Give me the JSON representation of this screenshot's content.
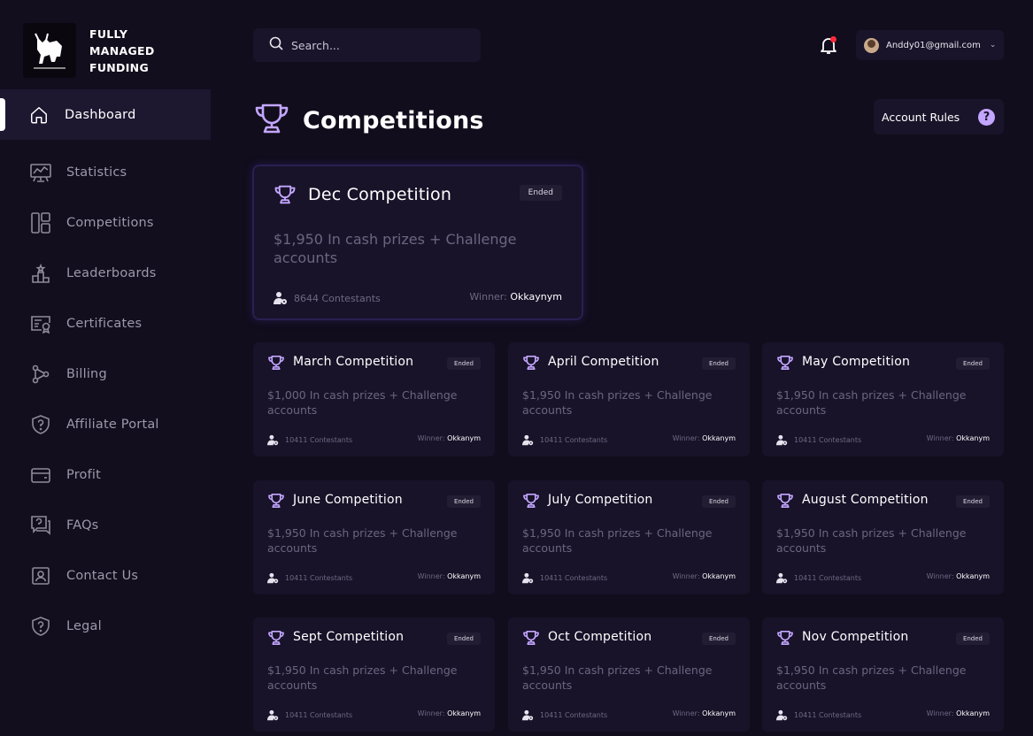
{
  "brand": {
    "line1": "FULLY",
    "line2": "MANAGED",
    "line3": "FUNDING"
  },
  "sidebar": {
    "items": [
      {
        "label": "Dashboard",
        "icon": "home-icon",
        "active": true
      },
      {
        "label": "Statistics",
        "icon": "statistics-icon"
      },
      {
        "label": "Competitions",
        "icon": "competitions-icon"
      },
      {
        "label": "Leaderboards",
        "icon": "leaderboards-icon"
      },
      {
        "label": "Certificates",
        "icon": "certificates-icon"
      },
      {
        "label": "Billing",
        "icon": "billing-icon"
      },
      {
        "label": "Affiliate Portal",
        "icon": "affiliate-icon"
      },
      {
        "label": "Profit",
        "icon": "wallet-icon"
      },
      {
        "label": "FAQs",
        "icon": "faqs-icon"
      },
      {
        "label": "Contact Us",
        "icon": "contact-icon"
      },
      {
        "label": "Legal",
        "icon": "legal-icon"
      }
    ]
  },
  "search": {
    "placeholder": "Search..."
  },
  "user": {
    "email": "Anddy01@gmail.com"
  },
  "page": {
    "title": "Competitions",
    "rules_label": "Account Rules"
  },
  "featured": {
    "title": "Dec Competition",
    "status": "Ended",
    "description": "$1,950 In cash prizes + Challenge accounts",
    "contestants": "8644 Contestants",
    "winner_label": "Winner:",
    "winner": "Okkaynym"
  },
  "cards": [
    {
      "title": "March Competition",
      "status": "Ended",
      "description": "$1,000 In cash prizes + Challenge accounts",
      "contestants": "10411 Contestants",
      "winner_label": "Winner:",
      "winner": "Okkanym"
    },
    {
      "title": "April Competition",
      "status": "Ended",
      "description": "$1,950 In cash prizes + Challenge accounts",
      "contestants": "10411 Contestants",
      "winner_label": "Winner:",
      "winner": "Okkanym"
    },
    {
      "title": "May Competition",
      "status": "Ended",
      "description": "$1,950 In cash prizes + Challenge accounts",
      "contestants": "10411 Contestants",
      "winner_label": "Winner:",
      "winner": "Okkanym"
    },
    {
      "title": "June Competition",
      "status": "Ended",
      "description": "$1,950 In cash prizes + Challenge accounts",
      "contestants": "10411 Contestants",
      "winner_label": "Winner:",
      "winner": "Okkanym"
    },
    {
      "title": "July Competition",
      "status": "Ended",
      "description": "$1,950 In cash prizes + Challenge accounts",
      "contestants": "10411 Contestants",
      "winner_label": "Winner:",
      "winner": "Okkanym"
    },
    {
      "title": "August Competition",
      "status": "Ended",
      "description": "$1,950 In cash prizes + Challenge accounts",
      "contestants": "10411 Contestants",
      "winner_label": "Winner:",
      "winner": "Okkanym"
    },
    {
      "title": "Sept Competition",
      "status": "Ended",
      "description": "$1,950 In cash prizes + Challenge accounts",
      "contestants": "10411 Contestants",
      "winner_label": "Winner:",
      "winner": "Okkanym"
    },
    {
      "title": "Oct Competition",
      "status": "Ended",
      "description": "$1,950 In cash prizes + Challenge accounts",
      "contestants": "10411 Contestants",
      "winner_label": "Winner:",
      "winner": "Okkanym"
    },
    {
      "title": "Nov Competition",
      "status": "Ended",
      "description": "$1,950 In cash prizes + Challenge accounts",
      "contestants": "10411 Contestants",
      "winner_label": "Winner:",
      "winner": "Okkanym"
    }
  ],
  "colors": {
    "background": "#110d1c",
    "card": "#181329",
    "accent": "#c3a6ff",
    "notification": "#ff2a3a"
  }
}
